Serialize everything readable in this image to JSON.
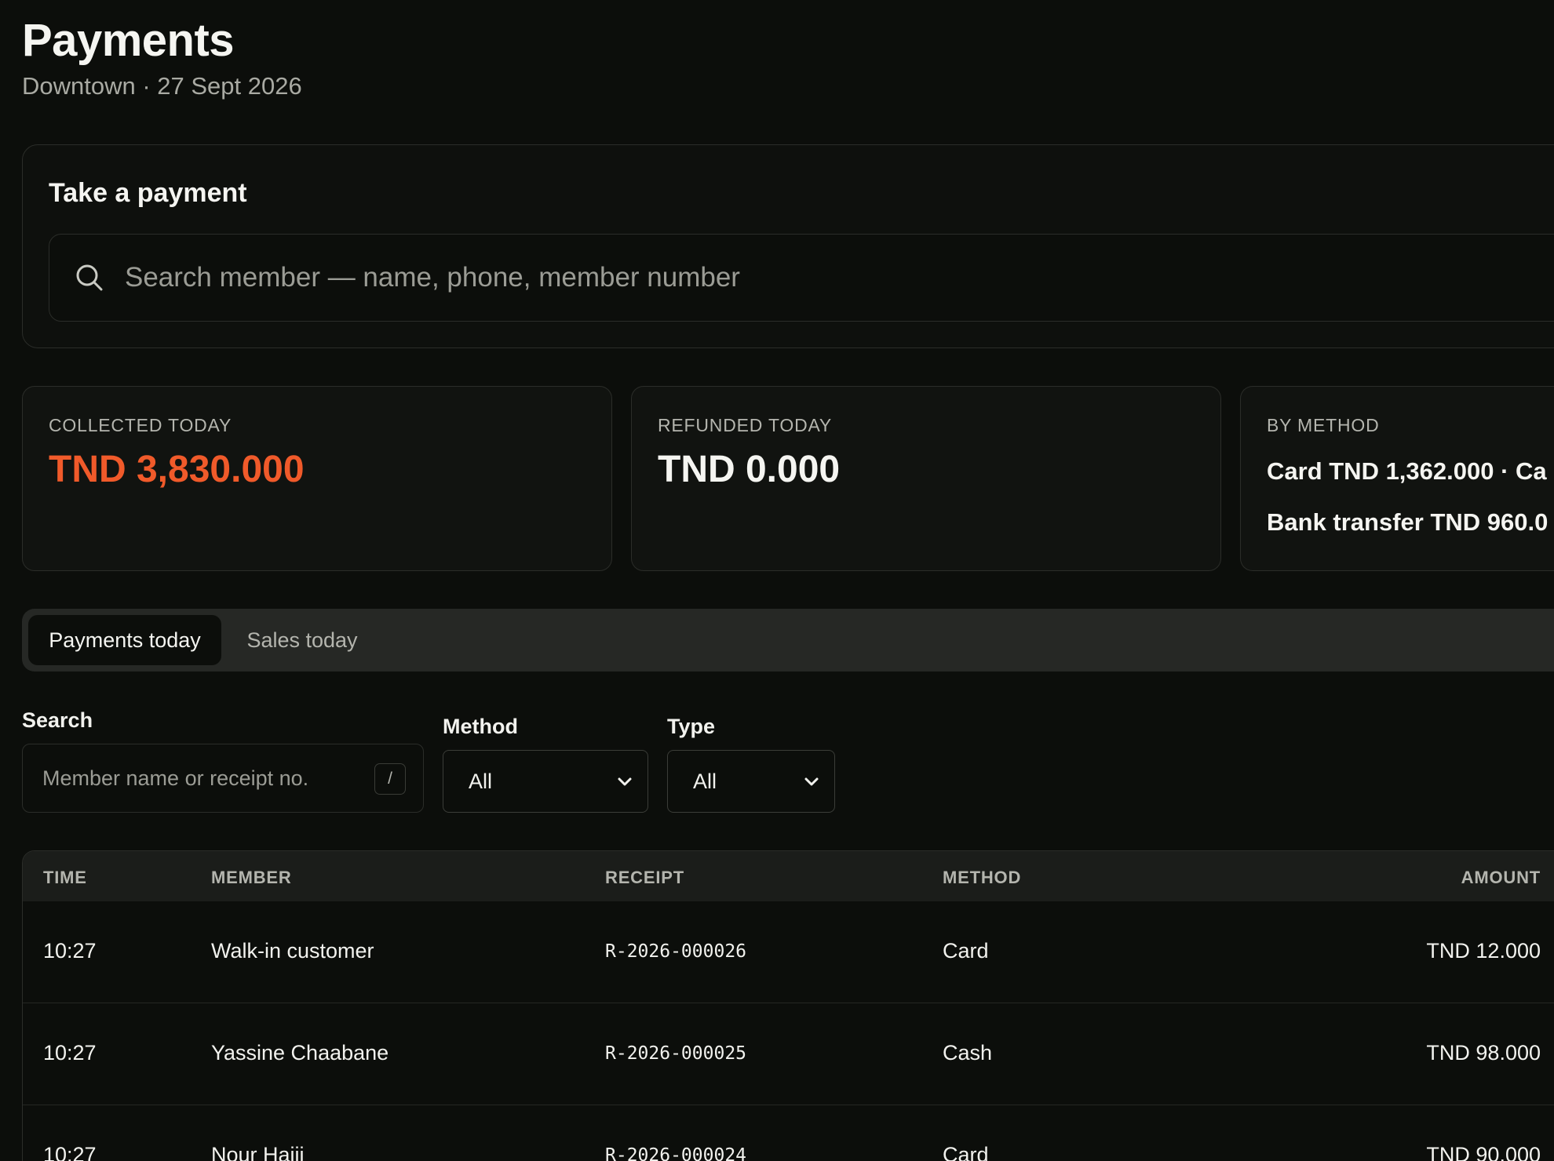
{
  "header": {
    "title": "Payments",
    "subtitle": "Downtown · 27 Sept 2026"
  },
  "take_payment": {
    "title": "Take a payment",
    "search_placeholder": "Search member — name, phone, member number",
    "search_icon": "search-icon"
  },
  "stats": {
    "collected": {
      "label": "COLLECTED TODAY",
      "value": "TND 3,830.000"
    },
    "refunded": {
      "label": "REFUNDED TODAY",
      "value": "TND 0.000"
    },
    "by_method": {
      "label": "BY METHOD",
      "line1": "Card TND 1,362.000 · Ca",
      "line2": "Bank transfer TND 960.0"
    }
  },
  "tabs": [
    {
      "label": "Payments today",
      "active": true
    },
    {
      "label": "Sales today",
      "active": false
    }
  ],
  "filters": {
    "search_label": "Search",
    "search_placeholder": "Member name or receipt no.",
    "search_shortcut": "/",
    "method_label": "Method",
    "method_value": "All",
    "type_label": "Type",
    "type_value": "All"
  },
  "table": {
    "columns": [
      "TIME",
      "MEMBER",
      "RECEIPT",
      "METHOD",
      "AMOUNT"
    ],
    "rows": [
      {
        "time": "10:27",
        "member": "Walk-in customer",
        "receipt": "R-2026-000026",
        "method": "Card",
        "amount": "TND 12.000"
      },
      {
        "time": "10:27",
        "member": "Yassine Chaabane",
        "receipt": "R-2026-000025",
        "method": "Cash",
        "amount": "TND 98.000"
      },
      {
        "time": "10:27",
        "member": "Nour Hajji",
        "receipt": "R-2026-000024",
        "method": "Card",
        "amount": "TND 90.000"
      }
    ]
  },
  "colors": {
    "background": "#0c0e0b",
    "accent": "#f05a2a",
    "border": "#2b2d29",
    "muted_text": "#a9aaa3"
  }
}
